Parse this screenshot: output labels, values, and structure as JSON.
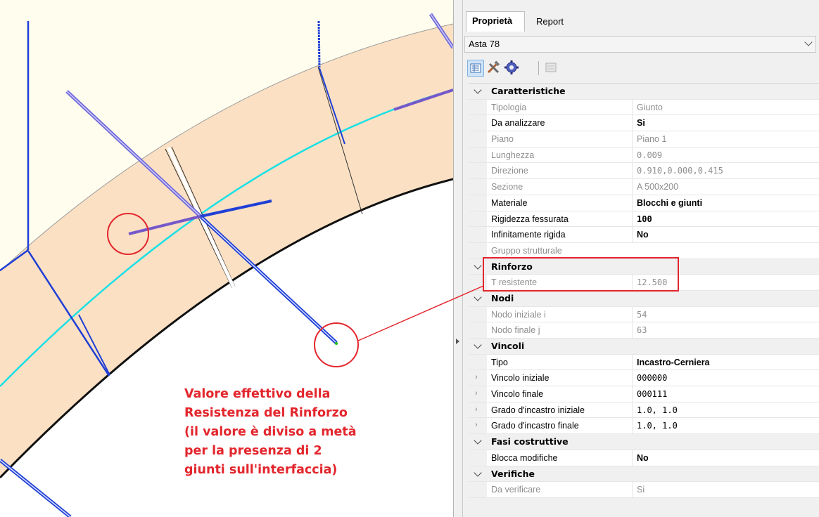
{
  "annotation": {
    "lines": [
      "Valore effettivo della",
      "Resistenza del Rinforzo",
      "(il valore è diviso a metà",
      "per la presenza di 2",
      "giunti sull'interfaccia)"
    ],
    "color": "#e3262d"
  },
  "panel": {
    "tabs": [
      {
        "label": "Proprietà",
        "active": true
      },
      {
        "label": "Report",
        "active": false
      }
    ],
    "selector": {
      "value": "Asta 78"
    },
    "toolbar": {
      "icons": [
        "property-grid-icon",
        "tools-icon",
        "gear-icon",
        "sheet-icon"
      ]
    },
    "sections": [
      {
        "title": "Caratteristiche",
        "rows": [
          {
            "name": "Tipologia",
            "value": "Giunto",
            "style": "gray"
          },
          {
            "name": "Da analizzare",
            "value": "Si",
            "style": "bold"
          },
          {
            "name": "Piano",
            "value": "Piano 1",
            "style": "gray"
          },
          {
            "name": "Lunghezza",
            "value": "0.009",
            "style": "gray-mono"
          },
          {
            "name": "Direzione",
            "value": "0.910,0.000,0.415",
            "style": "gray-mono"
          },
          {
            "name": "Sezione",
            "value": "A 500x200",
            "style": "gray"
          },
          {
            "name": "Materiale",
            "value": "Blocchi e giunti",
            "style": "bold"
          },
          {
            "name": "Rigidezza fessurata",
            "value": "100",
            "style": "bold"
          },
          {
            "name": "Infinitamente rigida",
            "value": "No",
            "style": "bold"
          },
          {
            "name": "Gruppo strutturale",
            "value": "",
            "style": "gray"
          }
        ]
      },
      {
        "title": "Rinforzo",
        "rows": [
          {
            "name": "T resistente",
            "value": "12.500",
            "style": "gray-mono"
          }
        ]
      },
      {
        "title": "Nodi",
        "rows": [
          {
            "name": "Nodo iniziale i",
            "value": "54",
            "style": "gray"
          },
          {
            "name": "Nodo finale j",
            "value": "63",
            "style": "gray"
          }
        ]
      },
      {
        "title": "Vincoli",
        "rows": [
          {
            "name": "Tipo",
            "value": "Incastro-Cerniera",
            "style": "bold"
          },
          {
            "name": "Vincolo iniziale",
            "value": "000000",
            "style": "mono",
            "expandable": true
          },
          {
            "name": "Vincolo finale",
            "value": "000111",
            "style": "mono",
            "expandable": true
          },
          {
            "name": "Grado d'incastro iniziale",
            "value": "1.0, 1.0",
            "style": "mono",
            "expandable": true
          },
          {
            "name": "Grado d'incastro finale",
            "value": "1.0, 1.0",
            "style": "mono",
            "expandable": true
          }
        ]
      },
      {
        "title": "Fasi costruttive",
        "rows": [
          {
            "name": "Blocca modifiche",
            "value": "No",
            "style": "bold"
          }
        ]
      },
      {
        "title": "Verifiche",
        "rows": [
          {
            "name": "Da verificare",
            "value": "Si",
            "style": "gray"
          }
        ]
      }
    ]
  },
  "colors": {
    "ring_fill": "#fbe0c4",
    "background_fill": "#fffdee",
    "member_blue": "#1f3fd6",
    "member_purple": "#7559c9",
    "axis_cyan": "#19e0e6",
    "highlight_red": "#e3262d"
  }
}
